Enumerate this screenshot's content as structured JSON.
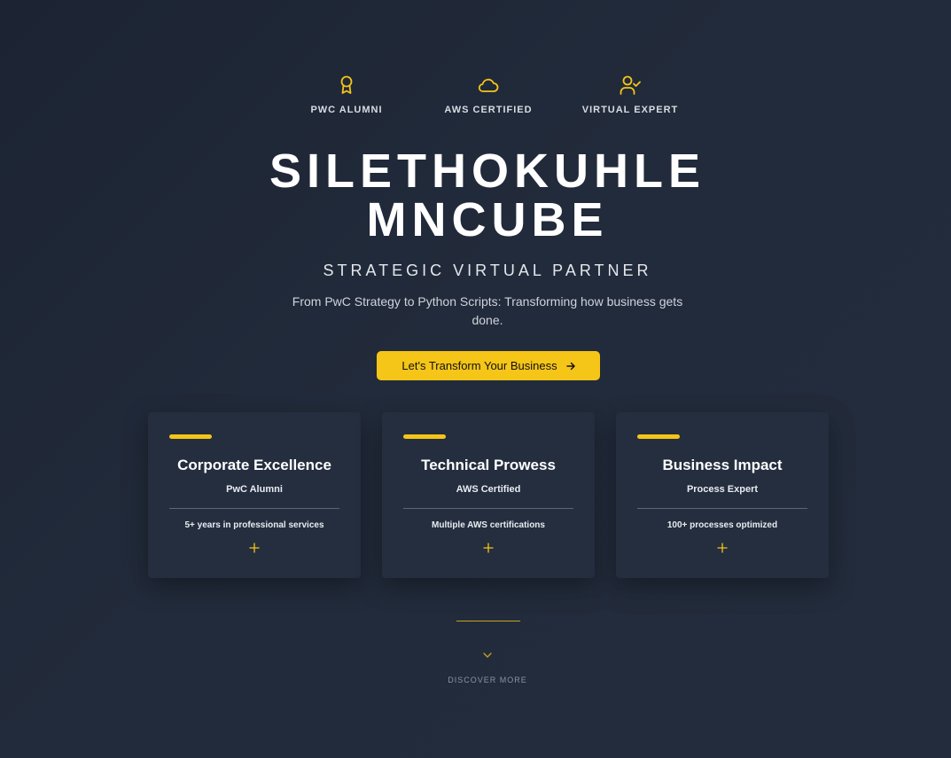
{
  "badges": [
    {
      "icon": "award-icon",
      "label": "PWC ALUMNI"
    },
    {
      "icon": "cloud-icon",
      "label": "AWS CERTIFIED"
    },
    {
      "icon": "user-check-icon",
      "label": "VIRTUAL EXPERT"
    }
  ],
  "hero": {
    "name_line1": "SILETHOKUHLE",
    "name_line2": "MNCUBE",
    "subtitle": "STRATEGIC VIRTUAL PARTNER",
    "tagline": "From PwC Strategy to Python Scripts: Transforming how business gets done.",
    "cta_label": "Let's Transform Your Business",
    "cta_icon": "arrow-right-icon"
  },
  "cards": [
    {
      "title": "Corporate Excellence",
      "subtitle": "PwC Alumni",
      "detail": "5+ years in professional services",
      "icon": "plus-icon"
    },
    {
      "title": "Technical Prowess",
      "subtitle": "AWS Certified",
      "detail": "Multiple AWS certifications",
      "icon": "plus-icon"
    },
    {
      "title": "Business Impact",
      "subtitle": "Process Expert",
      "detail": "100+ processes optimized",
      "icon": "plus-icon"
    }
  ],
  "footer": {
    "icon": "chevron-down-icon",
    "discover_label": "DISCOVER MORE"
  },
  "colors": {
    "accent": "#f5c518",
    "background": "#1e2636",
    "card": "#242e3f"
  }
}
